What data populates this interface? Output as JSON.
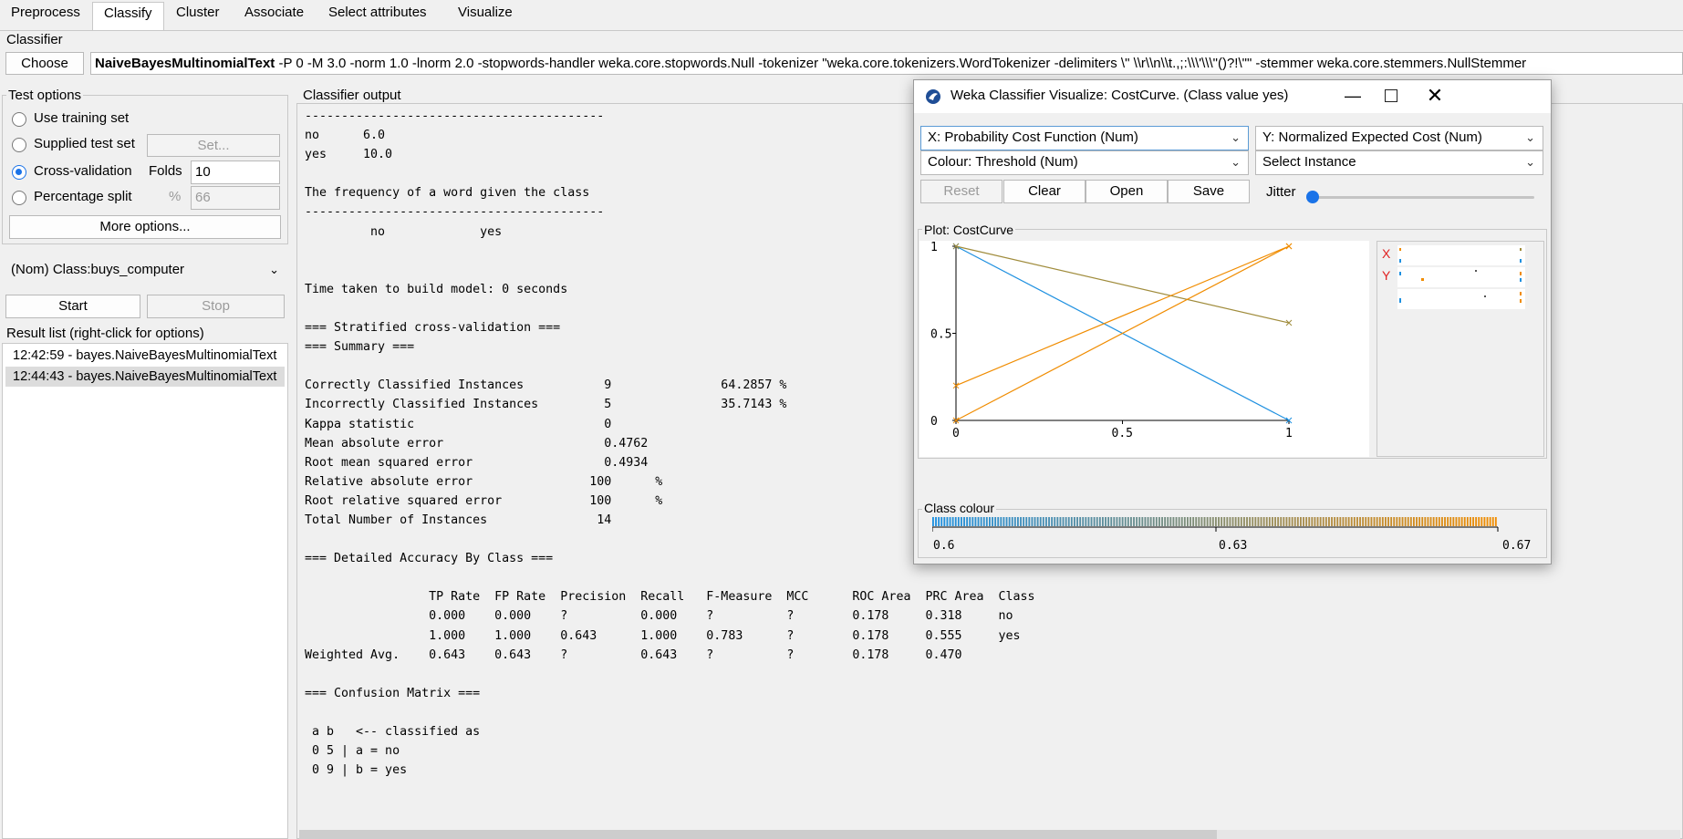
{
  "tabs": [
    "Preprocess",
    "Classify",
    "Cluster",
    "Associate",
    "Select attributes",
    "Visualize"
  ],
  "classifier": {
    "group_label": "Classifier",
    "choose_label": "Choose",
    "name": "NaiveBayesMultinomialText",
    "options": " -P 0 -M 3.0 -norm 1.0 -lnorm 2.0 -stopwords-handler weka.core.stopwords.Null -tokenizer \"weka.core.tokenizers.WordTokenizer -delimiters \\\" \\\\r\\\\n\\\\t.,;:\\\\\\'\\\\\\\"()?!\\\"\" -stemmer weka.core.stemmers.NullStemmer"
  },
  "test_options": {
    "label": "Test options",
    "use_training": "Use training set",
    "supplied": "Supplied test set",
    "set_label": "Set...",
    "cross_validation": "Cross-validation",
    "folds_label": "Folds",
    "folds_value": "10",
    "percentage_split": "Percentage split",
    "percent_sign": "%",
    "percent_value": "66",
    "more_options": "More options..."
  },
  "class_select": "(Nom) Class:buys_computer",
  "start_label": "Start",
  "stop_label": "Stop",
  "result_list": {
    "label": "Result list (right-click for options)",
    "items": [
      "12:42:59 - bayes.NaiveBayesMultinomialText",
      "12:44:43 - bayes.NaiveBayesMultinomialText"
    ]
  },
  "output": {
    "label": "Classifier output",
    "lines": [
      "-----------------------------------------",
      "no      6.0",
      "yes     10.0",
      "",
      "The frequency of a word given the class",
      "-----------------------------------------",
      "         no             yes",
      "",
      "",
      "Time taken to build model: 0 seconds",
      "",
      "=== Stratified cross-validation ===",
      "=== Summary ===",
      "",
      "Correctly Classified Instances           9               64.2857 %",
      "Incorrectly Classified Instances         5               35.7143 %",
      "Kappa statistic                          0",
      "Mean absolute error                      0.4762",
      "Root mean squared error                  0.4934",
      "Relative absolute error                100      %",
      "Root relative squared error            100      %",
      "Total Number of Instances               14",
      "",
      "=== Detailed Accuracy By Class ===",
      "",
      "                 TP Rate  FP Rate  Precision  Recall   F-Measure  MCC      ROC Area  PRC Area  Class",
      "                 0.000    0.000    ?          0.000    ?          ?        0.178     0.318     no",
      "                 1.000    1.000    0.643      1.000    0.783      ?        0.178     0.555     yes",
      "Weighted Avg.    0.643    0.643    ?          0.643    ?          ?        0.178     0.470",
      "",
      "=== Confusion Matrix ===",
      "",
      " a b   <-- classified as",
      " 0 5 | a = no",
      " 0 9 | b = yes"
    ]
  },
  "popup": {
    "title": "Weka Classifier Visualize: CostCurve. (Class value yes)",
    "x_combo": "X: Probability Cost Function (Num)",
    "y_combo": "Y: Normalized Expected Cost (Num)",
    "colour_combo": "Colour: Threshold (Num)",
    "instance_combo": "Select Instance",
    "reset_label": "Reset",
    "clear_label": "Clear",
    "open_label": "Open",
    "save_label": "Save",
    "jitter_label": "Jitter",
    "jitter_value": 0,
    "plot_label": "Plot: CostCurve",
    "x_marker": "X",
    "y_marker": "Y",
    "class_colour_label": "Class colour",
    "class_colour_ticks": [
      "0.6",
      "0.63",
      "0.67"
    ],
    "colors": {
      "blue": "#1e90e0",
      "orange": "#f08c00",
      "olive": "#a08c3c",
      "marker_red": "#e02020"
    }
  },
  "chart_data": {
    "type": "line",
    "title": "",
    "xlabel": "",
    "ylabel": "",
    "xlim": [
      0,
      1
    ],
    "ylim": [
      0,
      1
    ],
    "x_ticks": [
      "0",
      "0.5",
      "1"
    ],
    "y_ticks": [
      "0",
      "0.5",
      "1"
    ],
    "series": [
      {
        "color": "#1e90e0",
        "x": [
          0,
          1
        ],
        "y": [
          1,
          0
        ]
      },
      {
        "color": "#a08c3c",
        "x": [
          0,
          1
        ],
        "y": [
          1,
          0.56
        ]
      },
      {
        "color": "#f08c00",
        "x": [
          0,
          1
        ],
        "y": [
          0,
          1
        ]
      },
      {
        "color": "#f08c00",
        "x": [
          0,
          1
        ],
        "y": [
          0.2,
          1
        ]
      }
    ]
  }
}
